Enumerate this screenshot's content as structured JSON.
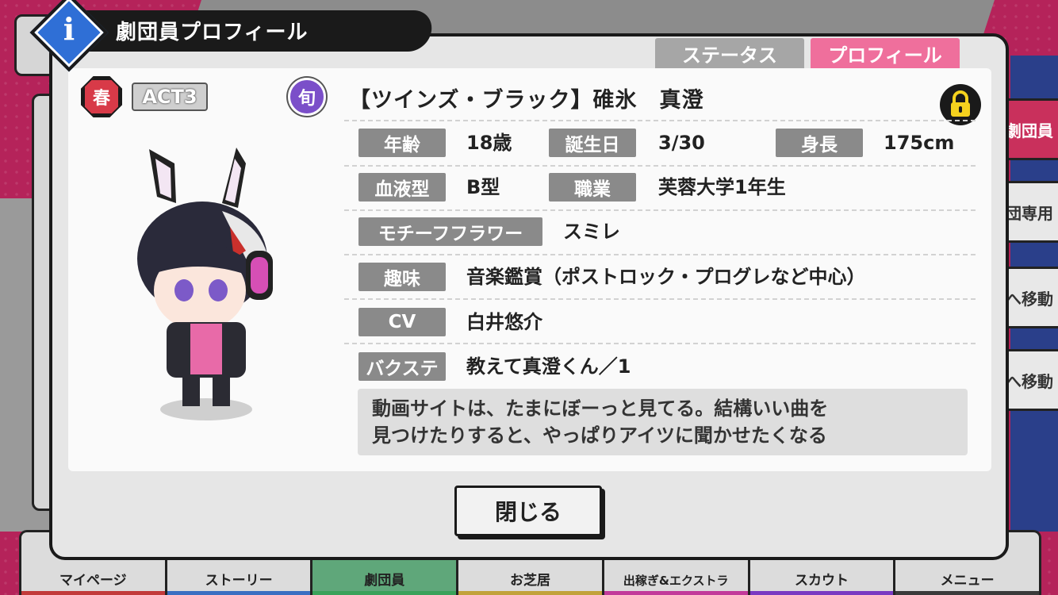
{
  "header": {
    "title": "劇団員プロフィール",
    "info_icon": "i"
  },
  "tabs": [
    {
      "label": "ステータス",
      "active": false
    },
    {
      "label": "プロフィール",
      "active": true
    }
  ],
  "badges": {
    "season": "春",
    "act": "ACT3",
    "shun": "旬"
  },
  "profile": {
    "name": "【ツインズ・ブラック】碓氷　真澄",
    "age_label": "年齢",
    "age": "18歳",
    "birthday_label": "誕生日",
    "birthday": "3/30",
    "height_label": "身長",
    "height": "175cm",
    "blood_label": "血液型",
    "blood": "B型",
    "job_label": "職業",
    "job": "芙蓉大学1年生",
    "flower_label": "モチーフフラワー",
    "flower": "スミレ",
    "hobby_label": "趣味",
    "hobby": "音楽鑑賞（ポストロック・プログレなど中心）",
    "cv_label": "CV",
    "cv": "白井悠介",
    "backstage_label": "バクステ",
    "backstage": "教えて真澄くん／1",
    "quote_line1": "動画サイトは、たまにぼーっと見てる。結構いい曲を",
    "quote_line2": "見つけたりすると、やっぱりアイツに聞かせたくなる"
  },
  "close_label": "閉じる",
  "side_tabs": [
    "劇団員",
    "劇団専用",
    "へ移動",
    "へ移動"
  ],
  "bottom_nav": [
    {
      "label": "マイページ",
      "color": "#c23a3a",
      "active": false
    },
    {
      "label": "ストーリー",
      "color": "#3a6fc2",
      "active": false
    },
    {
      "label": "劇団員",
      "color": "#3aa25a",
      "active": true
    },
    {
      "label": "お芝居",
      "color": "#c2a23a",
      "active": false
    },
    {
      "label": "出稼ぎ&エクストラ",
      "color": "#c23a9a",
      "active": false
    },
    {
      "label": "スカウト",
      "color": "#7a3ac2",
      "active": false
    },
    {
      "label": "メニュー",
      "color": "#3a3a3a",
      "active": false
    }
  ],
  "colors": {
    "background": "#b5235a",
    "profile_tab": "#ef6f9c",
    "status_tab": "#a6a6a6",
    "label_bg": "#8a8a8a",
    "info_blue": "#2f6fd6",
    "lock_yellow": "#f5d21e"
  },
  "icons": {
    "info": "info-icon",
    "lock": "lock-icon",
    "back": "back-arrow-icon"
  }
}
